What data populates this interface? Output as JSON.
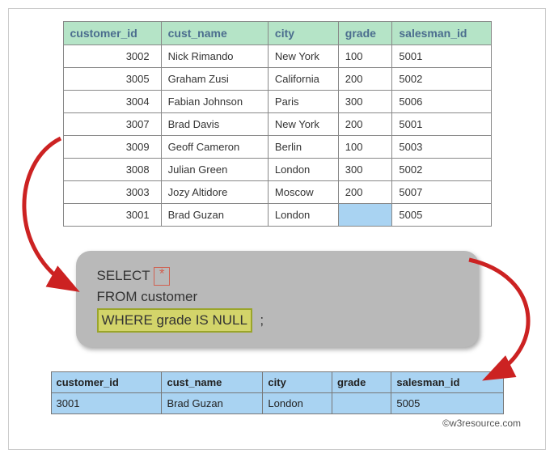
{
  "source_table": {
    "headers": [
      "customer_id",
      "cust_name",
      "city",
      "grade",
      "salesman_id"
    ],
    "rows": [
      {
        "customer_id": "3002",
        "cust_name": "Nick Rimando",
        "city": "New York",
        "grade": "100",
        "salesman_id": "5001"
      },
      {
        "customer_id": "3005",
        "cust_name": "Graham Zusi",
        "city": "California",
        "grade": "200",
        "salesman_id": "5002"
      },
      {
        "customer_id": "3004",
        "cust_name": "Fabian Johnson",
        "city": "Paris",
        "grade": "300",
        "salesman_id": "5006"
      },
      {
        "customer_id": "3007",
        "cust_name": "Brad Davis",
        "city": "New York",
        "grade": "200",
        "salesman_id": "5001"
      },
      {
        "customer_id": "3009",
        "cust_name": "Geoff Cameron",
        "city": "Berlin",
        "grade": "100",
        "salesman_id": "5003"
      },
      {
        "customer_id": "3008",
        "cust_name": "Julian Green",
        "city": "London",
        "grade": "300",
        "salesman_id": "5002"
      },
      {
        "customer_id": "3003",
        "cust_name": "Jozy Altidore",
        "city": "Moscow",
        "grade": "200",
        "salesman_id": "5007"
      },
      {
        "customer_id": "3001",
        "cust_name": "Brad Guzan",
        "city": "London",
        "grade": "",
        "salesman_id": "5005",
        "grade_null": true
      }
    ]
  },
  "query": {
    "select": "SELECT",
    "star": "*",
    "from": "FROM customer",
    "where": "WHERE grade IS NULL",
    "semicolon": ";"
  },
  "result_table": {
    "headers": [
      "customer_id",
      "cust_name",
      "city",
      "grade",
      "salesman_id"
    ],
    "rows": [
      {
        "customer_id": "3001",
        "cust_name": "Brad Guzan",
        "city": "London",
        "grade": "",
        "salesman_id": "5005"
      }
    ]
  },
  "credit": "©w3resource.com"
}
